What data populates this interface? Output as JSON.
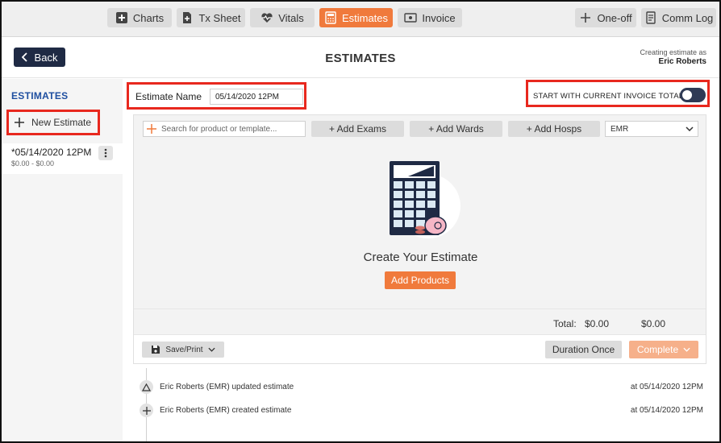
{
  "nav": {
    "charts": "Charts",
    "tx_sheet": "Tx Sheet",
    "vitals": "Vitals",
    "estimates": "Estimates",
    "invoice": "Invoice",
    "one_off": "One-off",
    "comm_log": "Comm Log"
  },
  "header": {
    "back": "Back",
    "title": "ESTIMATES",
    "creating_as": "Creating estimate as",
    "user": "Eric Roberts"
  },
  "sidebar": {
    "title": "ESTIMATES",
    "new_estimate": "New Estimate",
    "items": [
      {
        "name": "*05/14/2020 12PM",
        "range": "$0.00 - $0.00"
      }
    ]
  },
  "estimate": {
    "name_label": "Estimate Name",
    "name_value": "05/14/2020 12PM",
    "toggle_label": "START WITH CURRENT INVOICE TOTAL",
    "toggle_on": true
  },
  "toolbar": {
    "search_placeholder": "Search for product or template...",
    "add_exams": "+ Add Exams",
    "add_wards": "+ Add Wards",
    "add_hosps": "+ Add Hosps",
    "emr_select": "EMR"
  },
  "empty_state": {
    "title": "Create Your Estimate",
    "add_products": "Add Products"
  },
  "totals": {
    "label": "Total:",
    "low": "$0.00",
    "high": "$0.00"
  },
  "footer": {
    "save_print": "Save/Print",
    "duration": "Duration Once",
    "complete": "Complete"
  },
  "activity": [
    {
      "text": "Eric Roberts (EMR) updated estimate",
      "time": "at 05/14/2020 12PM",
      "icon": "triangle-icon"
    },
    {
      "text": "Eric Roberts (EMR) created estimate",
      "time": "at 05/14/2020 12PM",
      "icon": "plus-icon"
    }
  ],
  "colors": {
    "accent": "#f07a3c",
    "navy": "#1f2a44",
    "highlight": "#e8281e",
    "link_blue": "#1f4fa0"
  }
}
